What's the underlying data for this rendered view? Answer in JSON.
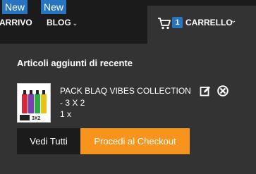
{
  "nav": {
    "items": [
      {
        "badge": "New",
        "label": "ARRIVO"
      },
      {
        "badge": "New",
        "label": "BLOG",
        "caret": "⌄"
      }
    ]
  },
  "cart": {
    "icon": "cart-icon",
    "count": "1",
    "label": "CARRELLO",
    "caret": "⌄"
  },
  "dropdown": {
    "title": "Articoli aggiunti di recente",
    "item": {
      "name": "PACK BLAQ VIBES COLLECTION - 3 X 2",
      "quantity": "1 x",
      "thumb_caption": "3X2"
    },
    "buttons": {
      "view_all": "Vedi Tutti",
      "checkout": "Procedi al Checkout"
    }
  },
  "colors": {
    "background": "#1b1b1b",
    "panel": "#333333",
    "accent_blue": "#2874c0",
    "checkout_orange": "#f7941d"
  }
}
